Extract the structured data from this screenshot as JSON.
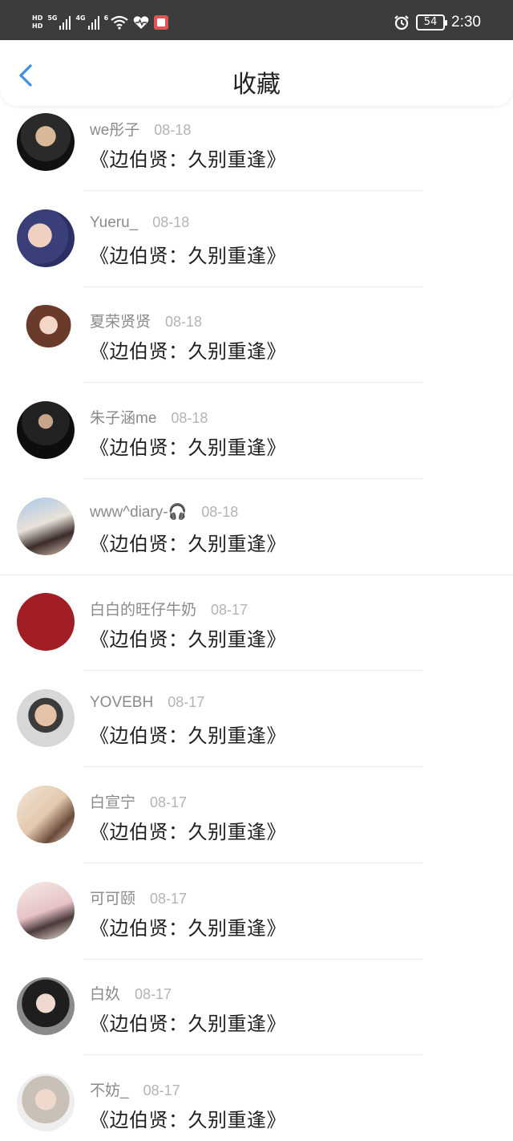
{
  "status_bar": {
    "hd_top": "HD",
    "hd_bottom": "HD",
    "net1": "5G",
    "net2": "4G",
    "wifi_tag": "6",
    "battery": "54",
    "time": "2:30"
  },
  "header": {
    "title": "收藏"
  },
  "items": [
    {
      "user": "we彤子",
      "date": "08-18",
      "title": "《边伯贤：久别重逢》"
    },
    {
      "user": "Yueru_",
      "date": "08-18",
      "title": "《边伯贤：久别重逢》"
    },
    {
      "user": "夏荣贤贤",
      "date": "08-18",
      "title": "《边伯贤：久别重逢》"
    },
    {
      "user": "朱子涵me",
      "date": "08-18",
      "title": "《边伯贤：久别重逢》"
    },
    {
      "user": "www^diary-🎧",
      "date": "08-18",
      "title": "《边伯贤：久别重逢》"
    },
    {
      "user": "白白的旺仔牛奶",
      "date": "08-17",
      "title": "《边伯贤：久别重逢》"
    },
    {
      "user": "YOVEBH",
      "date": "08-17",
      "title": "《边伯贤：久别重逢》"
    },
    {
      "user": "白宣宁",
      "date": "08-17",
      "title": "《边伯贤：久别重逢》"
    },
    {
      "user": "可可颐",
      "date": "08-17",
      "title": "《边伯贤：久别重逢》"
    },
    {
      "user": "白奺",
      "date": "08-17",
      "title": "《边伯贤：久别重逢》"
    },
    {
      "user": "不妨_",
      "date": "08-17",
      "title": "《边伯贤：久别重逢》"
    }
  ],
  "colors": {
    "status_bar_bg": "#3c3c3c",
    "accent_blue": "#3d8ee8",
    "username_gray": "#8a8a8a",
    "date_gray": "#b4b4b4"
  }
}
